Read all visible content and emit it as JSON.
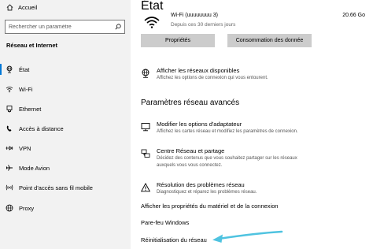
{
  "sidebar": {
    "home_label": "Accueil",
    "search_placeholder": "Rechercher un paramètre",
    "section_title": "Réseau et Internet",
    "items": [
      {
        "label": "État",
        "icon": "globe-network-icon",
        "active": true
      },
      {
        "label": "Wi-Fi",
        "icon": "wifi-icon",
        "active": false
      },
      {
        "label": "Ethernet",
        "icon": "ethernet-icon",
        "active": false
      },
      {
        "label": "Accès à distance",
        "icon": "dialup-icon",
        "active": false
      },
      {
        "label": "VPN",
        "icon": "vpn-icon",
        "active": false
      },
      {
        "label": "Mode Avion",
        "icon": "airplane-icon",
        "active": false
      },
      {
        "label": "Point d'accès sans fil mobile",
        "icon": "hotspot-icon",
        "active": false
      },
      {
        "label": "Proxy",
        "icon": "globe-icon",
        "active": false
      }
    ]
  },
  "main": {
    "title": "État",
    "wifi": {
      "name": "Wi-Fi (uuuuuuuu 3)",
      "status": "Depuis ces 30 derniers jours",
      "data_used": "20.66 Go"
    },
    "buttons": {
      "properties": "Propriétés",
      "data_usage": "Consommation des donnée"
    },
    "show_networks": {
      "title": "Afficher les réseaux disponibles",
      "desc": "Affichez les options de connexion qui vous entourent."
    },
    "advanced_heading": "Paramètres réseau avancés",
    "adapter": {
      "title": "Modifier les options d'adaptateur",
      "desc": "Affichez les cartes réseau et modifiez les paramètres de connexion."
    },
    "sharing": {
      "title": "Centre Réseau et partage",
      "desc1": "Décidez des contenus que vous souhaitez partager sur les réseaux",
      "desc2": "auxquels vous vous connectez."
    },
    "troubleshoot": {
      "title": "Résolution des problèmes réseau",
      "desc": "Diagnostiquez et réparez les problèmes réseau."
    },
    "links": {
      "hardware": "Afficher les propriétés du matériel et de la connexion",
      "firewall": "Pare-feu Windows",
      "reset": "Réinitialisation du réseau"
    }
  },
  "colors": {
    "accent": "#0078d7",
    "annotation_arrow": "#4fc3e0",
    "button_bg": "#cccccc",
    "sidebar_bg": "#f2f2f2"
  }
}
